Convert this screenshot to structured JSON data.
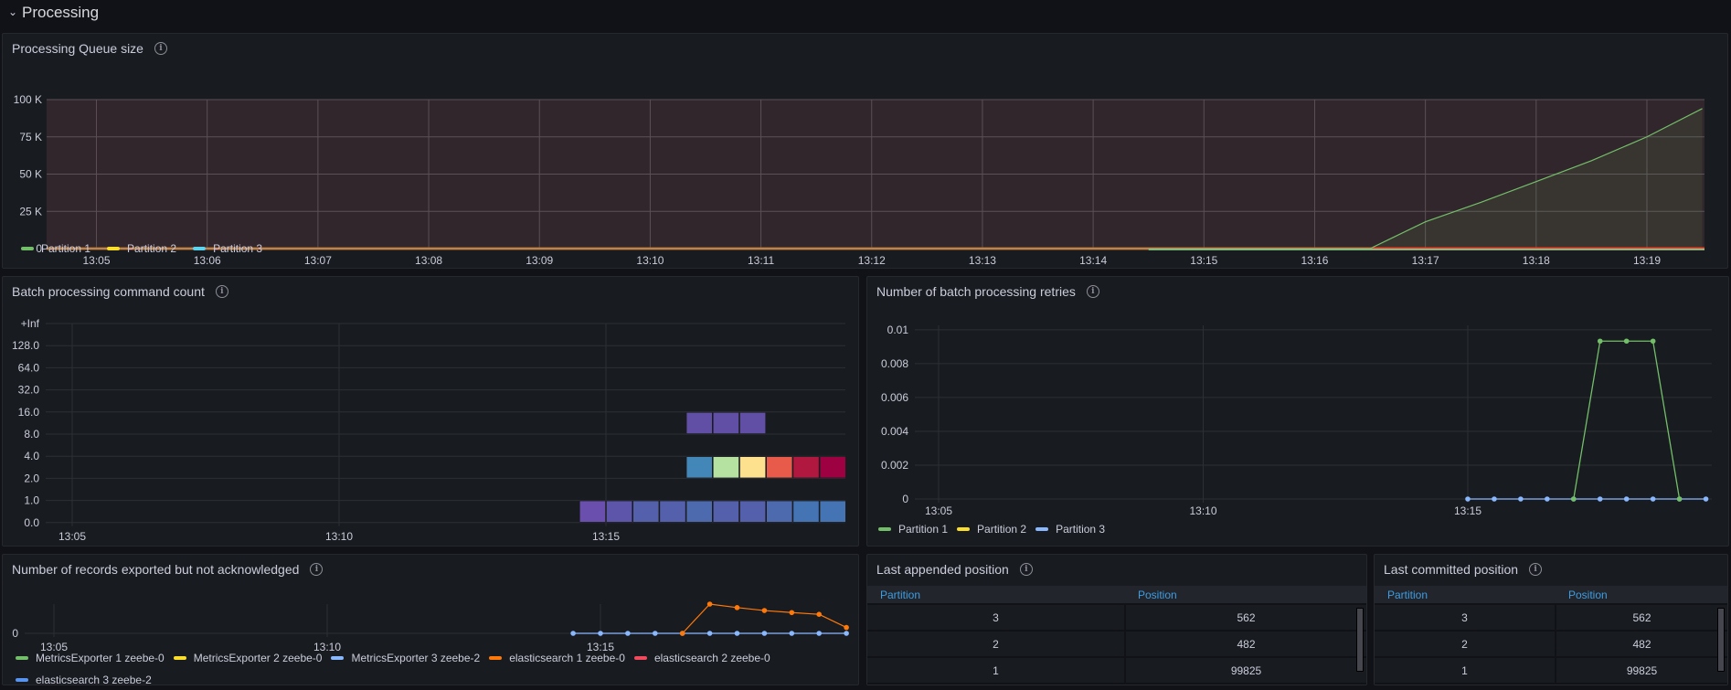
{
  "row": {
    "title": "Processing",
    "chevron": "⌄"
  },
  "panels": {
    "queue": {
      "title": "Processing Queue size",
      "legend": [
        {
          "name": "Partition 1",
          "color": "#73bf69"
        },
        {
          "name": "Partition 2",
          "color": "#fade2a"
        },
        {
          "name": "Partition 3",
          "color": "#5cd4f0"
        }
      ]
    },
    "batch": {
      "title": "Batch processing command count"
    },
    "retries": {
      "title": "Number of batch processing retries",
      "legend": [
        {
          "name": "Partition 1",
          "color": "#73bf69"
        },
        {
          "name": "Partition 2",
          "color": "#fade2a"
        },
        {
          "name": "Partition 3",
          "color": "#8ab8ff"
        }
      ]
    },
    "exported": {
      "title": "Number of records exported but not acknowledged",
      "legend": [
        {
          "name": "MetricsExporter 1 zeebe-0",
          "color": "#73bf69"
        },
        {
          "name": "MetricsExporter 2 zeebe-0",
          "color": "#fade2a"
        },
        {
          "name": "MetricsExporter 3 zeebe-2",
          "color": "#8ab8ff"
        },
        {
          "name": "elasticsearch 1 zeebe-0",
          "color": "#ff780a"
        },
        {
          "name": "elasticsearch 2 zeebe-0",
          "color": "#f2495c"
        },
        {
          "name": "elasticsearch 3 zeebe-2",
          "color": "#5794f2"
        }
      ]
    },
    "appended": {
      "title": "Last appended position",
      "columns": [
        "Partition",
        "Position"
      ],
      "rows": [
        [
          "3",
          "562"
        ],
        [
          "2",
          "482"
        ],
        [
          "1",
          "99825"
        ]
      ]
    },
    "committed": {
      "title": "Last committed position",
      "columns": [
        "Partition",
        "Position"
      ],
      "rows": [
        [
          "3",
          "562"
        ],
        [
          "2",
          "482"
        ],
        [
          "1",
          "99825"
        ]
      ]
    }
  },
  "chart_data": [
    {
      "id": "queue",
      "type": "area",
      "title": "Processing Queue size",
      "x_ticks": [
        "13:05",
        "13:06",
        "13:07",
        "13:08",
        "13:09",
        "13:10",
        "13:11",
        "13:12",
        "13:13",
        "13:14",
        "13:15",
        "13:16",
        "13:17",
        "13:18",
        "13:19"
      ],
      "y_ticks": [
        "0",
        "25 K",
        "50 K",
        "75 K",
        "100 K"
      ],
      "ylim": [
        0,
        100000
      ],
      "xlim_minutes": [
        4.55,
        19.52
      ],
      "threshold": {
        "color": "#e0472a",
        "region_color": "#31262b"
      },
      "series": [
        {
          "name": "Partition 1",
          "color": "#73bf69",
          "x_minutes": [
            4.55,
            14.5,
            16.5,
            17.0,
            17.5,
            18.0,
            18.5,
            19.0,
            19.5
          ],
          "values": [
            0,
            0,
            0,
            18000,
            31000,
            45000,
            59000,
            75000,
            94000
          ]
        },
        {
          "name": "Partition 2",
          "color": "#fade2a",
          "x_minutes": [
            4.55,
            19.52
          ],
          "values": [
            0,
            0
          ]
        },
        {
          "name": "Partition 3",
          "color": "#5cd4f0",
          "x_minutes": [
            4.55,
            19.52
          ],
          "values": [
            0,
            0
          ]
        }
      ],
      "legend_position": "bottom-left"
    },
    {
      "id": "batch",
      "type": "heatmap",
      "title": "Batch processing command count",
      "y_buckets": [
        "0.0",
        "1.0",
        "2.0",
        "4.0",
        "8.0",
        "16.0",
        "32.0",
        "64.0",
        "128.0",
        "+Inf"
      ],
      "x_ticks": [
        "13:05",
        "13:10",
        "13:15"
      ],
      "xlim_minutes": [
        4.5,
        19.9
      ],
      "cell_width_minutes": 0.5,
      "cells": [
        {
          "bucket": "1.0",
          "start": 14.5,
          "color": "#6a4fae"
        },
        {
          "bucket": "1.0",
          "start": 15.0,
          "color": "#5c55aa"
        },
        {
          "bucket": "1.0",
          "start": 15.5,
          "color": "#5460ab"
        },
        {
          "bucket": "1.0",
          "start": 16.0,
          "color": "#5460ab"
        },
        {
          "bucket": "1.0",
          "start": 16.5,
          "color": "#4e6aaf"
        },
        {
          "bucket": "1.0",
          "start": 17.0,
          "color": "#5460ab"
        },
        {
          "bucket": "1.0",
          "start": 17.5,
          "color": "#5460ab"
        },
        {
          "bucket": "1.0",
          "start": 18.0,
          "color": "#4e6aaf"
        },
        {
          "bucket": "1.0",
          "start": 18.5,
          "color": "#4474b3"
        },
        {
          "bucket": "1.0",
          "start": 19.0,
          "color": "#4474b3"
        },
        {
          "bucket": "4.0",
          "start": 16.5,
          "color": "#4387b8"
        },
        {
          "bucket": "4.0",
          "start": 17.0,
          "color": "#b5e2a1"
        },
        {
          "bucket": "4.0",
          "start": 17.5,
          "color": "#fee18f"
        },
        {
          "bucket": "4.0",
          "start": 18.0,
          "color": "#e85b4b"
        },
        {
          "bucket": "4.0",
          "start": 18.5,
          "color": "#b0183f"
        },
        {
          "bucket": "4.0",
          "start": 19.0,
          "color": "#9e0142"
        },
        {
          "bucket": "16.0",
          "start": 16.5,
          "color": "#614ea5"
        },
        {
          "bucket": "16.0",
          "start": 17.0,
          "color": "#614ea5"
        },
        {
          "bucket": "16.0",
          "start": 17.5,
          "color": "#614ea5"
        }
      ]
    },
    {
      "id": "retries",
      "type": "line",
      "title": "Number of batch processing retries",
      "y_ticks": [
        "0",
        "0.002",
        "0.004",
        "0.006",
        "0.008",
        "0.01"
      ],
      "ylim": [
        0,
        0.0101
      ],
      "x_ticks": [
        "13:05",
        "13:10",
        "13:15"
      ],
      "xlim_minutes": [
        4.55,
        19.9
      ],
      "series": [
        {
          "name": "Partition 1",
          "color": "#73bf69",
          "x_minutes": [
            17.0,
            17.5,
            18.0,
            18.5,
            19.0
          ],
          "values": [
            0,
            0.00933,
            0.00933,
            0.00933,
            0
          ]
        },
        {
          "name": "Partition 3",
          "color": "#8ab8ff",
          "x_minutes": [
            15.0,
            15.5,
            16.0,
            16.5,
            17.0,
            17.5,
            18.0,
            18.5,
            19.0,
            19.5
          ],
          "values": [
            0,
            0,
            0,
            0,
            0,
            0,
            0,
            0,
            0,
            0
          ]
        }
      ],
      "legend_position": "bottom-left"
    },
    {
      "id": "exported",
      "type": "line",
      "title": "Number of records exported but not acknowledged",
      "y_ticks": [
        "0"
      ],
      "x_ticks": [
        "13:05",
        "13:10",
        "13:15"
      ],
      "xlim_minutes": [
        4.55,
        19.95
      ],
      "series": [
        {
          "name": "elasticsearch 1 zeebe-0",
          "color": "#ff780a",
          "x_minutes": [
            16.5,
            17.0,
            17.5,
            18.0,
            18.5,
            19.0,
            19.5
          ],
          "values": [
            0,
            1.0,
            0.88,
            0.78,
            0.71,
            0.65,
            0.2
          ]
        },
        {
          "name": "MetricsExporter 3 zeebe-2",
          "color": "#8ab8ff",
          "x_minutes": [
            14.5,
            15.0,
            15.5,
            16.0,
            16.5,
            17.0,
            17.5,
            18.0,
            18.5,
            19.0,
            19.5
          ],
          "values": [
            0,
            0,
            0,
            0,
            0,
            0,
            0,
            0,
            0,
            0,
            0
          ]
        }
      ],
      "legend_position": "bottom-left"
    }
  ]
}
